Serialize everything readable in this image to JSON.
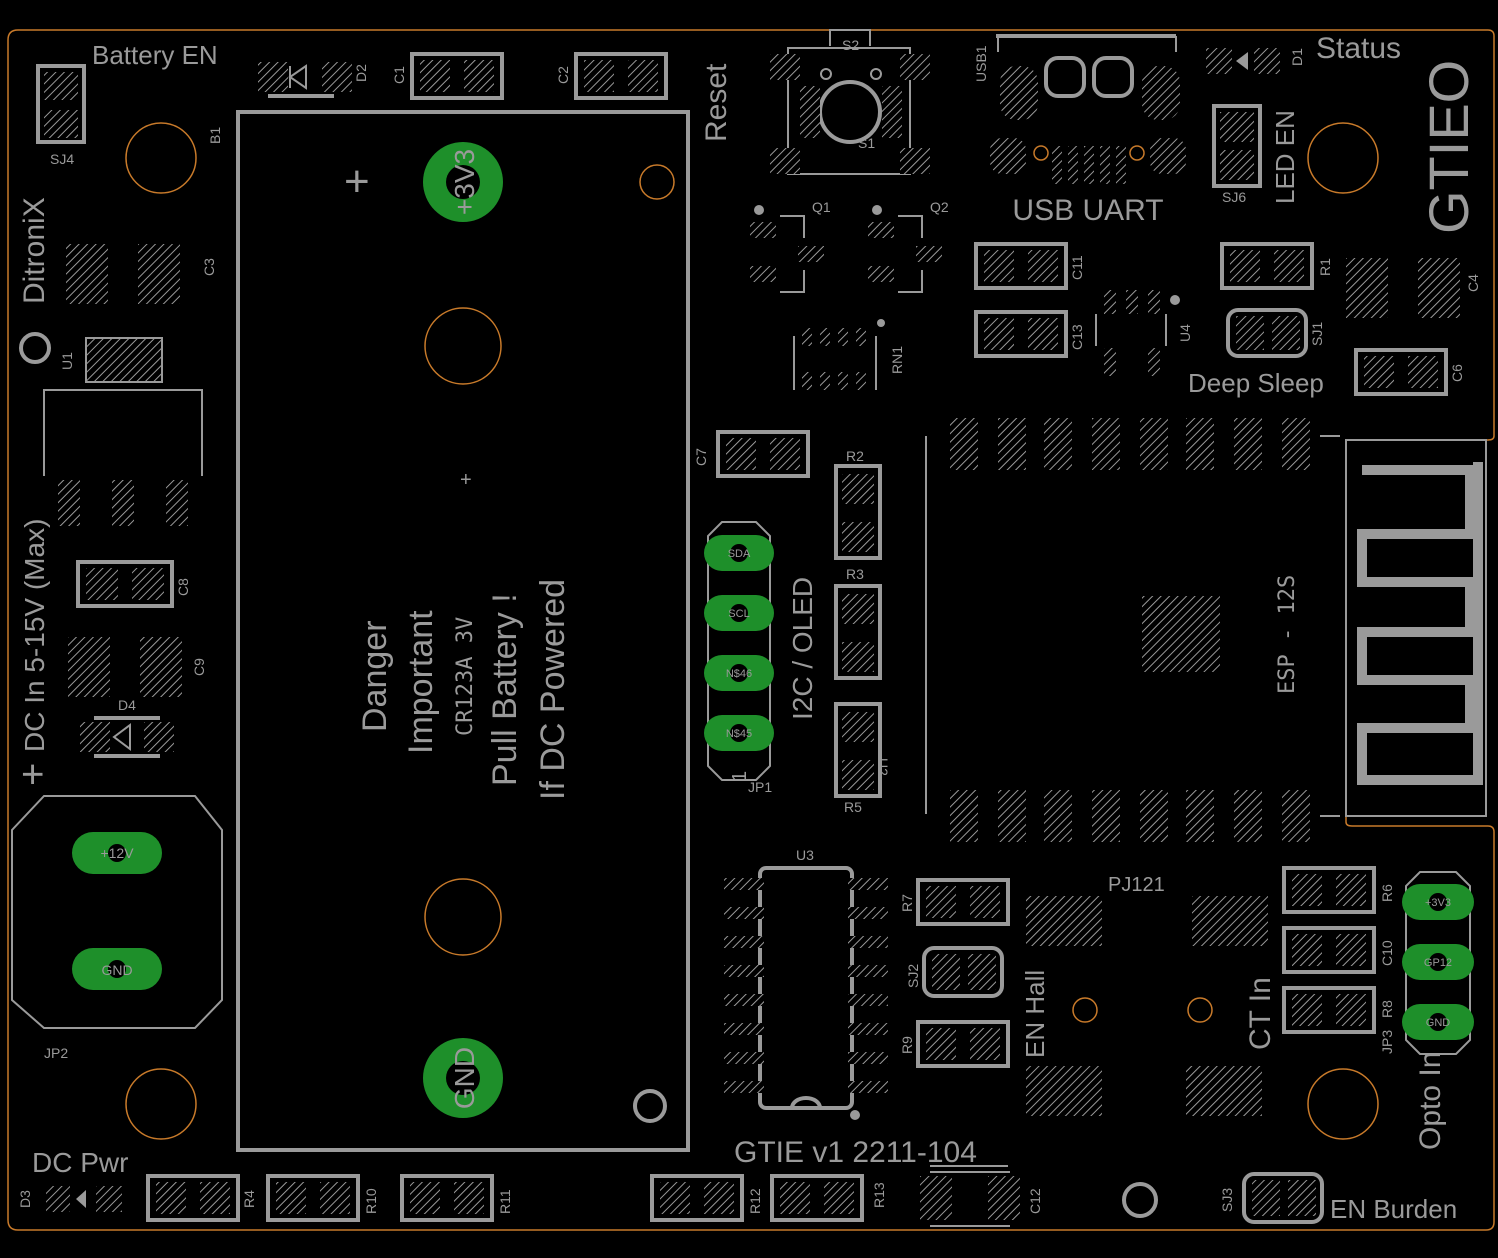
{
  "board": {
    "outline_color": "#c87a2a",
    "silk_color": "#9a9a9a",
    "copper_color": "#1e8f2a",
    "background": "#000000",
    "title": "GTIEO",
    "version": "GTIE v1 2211-104",
    "brand": "DitroniX"
  },
  "labels": {
    "battery_en": "Battery EN",
    "status": "Status",
    "reset": "Reset",
    "usb_uart": "USB UART",
    "led_en": "LED EN",
    "deep_sleep": "Deep Sleep",
    "dc_in": "DC In 5-15V (Max)",
    "plus": "+",
    "danger": "Danger",
    "important": "Important",
    "cr123a": "CR123A 3V",
    "pull_battery": "Pull Battery !",
    "if_dc": "If DC Powered",
    "i2c_oled": "I2C / OLED",
    "esp": "ESP - 12S",
    "en_hall": "EN Hall",
    "ct_in": "CT In",
    "opto_in": "Opto In",
    "dc_pwr": "DC Pwr",
    "en_burden": "EN Burden",
    "pj": "PJ121"
  },
  "refs": {
    "sj4": "SJ4",
    "d2": "D2",
    "c1": "C1",
    "c2": "C2",
    "s2": "S2",
    "s1": "S1",
    "usb1": "USB1",
    "d1": "D1",
    "b1": "B1",
    "c3": "C3",
    "u1": "U1",
    "sj6": "SJ6",
    "q1": "Q1",
    "q2": "Q2",
    "c11": "C11",
    "r1": "R1",
    "c4": "C4",
    "c13": "C13",
    "u4": "U4",
    "rn1": "RN1",
    "sj1": "SJ1",
    "c6": "C6",
    "c7": "C7",
    "r2": "R2",
    "c8": "C8",
    "r3": "R3",
    "c9": "C9",
    "d4": "D4",
    "u2": "U2",
    "r5": "R5",
    "jp1": "JP1",
    "jp1_pin": "1",
    "u3": "U3",
    "r7": "R7",
    "sj2": "SJ2",
    "r9": "R9",
    "r6": "R6",
    "c10": "C10",
    "r8": "R8",
    "jp3": "JP3",
    "jp2": "JP2",
    "d3": "D3",
    "r4": "R4",
    "r10": "R10",
    "r11": "R11",
    "r12": "R12",
    "r13": "R13",
    "c12": "C12",
    "sj3": "SJ3"
  },
  "pads": {
    "v3v3_batt": "+3V3",
    "gnd_batt": "GND",
    "v12": "+12V",
    "gnd_dc": "GND",
    "sda": "SDA",
    "scl": "SCL",
    "n46": "N$46",
    "n45": "N$45",
    "jp3_3v3": "+3V3",
    "jp3_gp12": "GP12",
    "jp3_gnd": "GND"
  }
}
